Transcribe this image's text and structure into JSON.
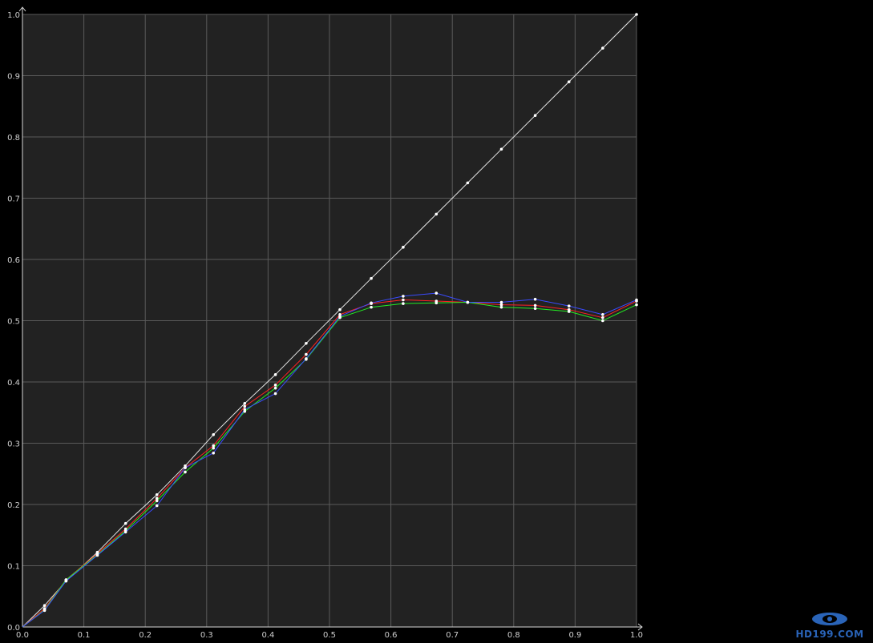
{
  "chart_data": {
    "type": "line",
    "title": "",
    "xlabel": "",
    "ylabel": "",
    "xlim": [
      0,
      1
    ],
    "ylim": [
      0,
      1
    ],
    "grid": true,
    "x_ticks": [
      "0.0",
      "0.1",
      "0.2",
      "0.3",
      "0.4",
      "0.5",
      "0.6",
      "0.7",
      "0.8",
      "0.9",
      "1.0"
    ],
    "y_ticks": [
      "0.0",
      "0.1",
      "0.2",
      "0.3",
      "0.4",
      "0.5",
      "0.6",
      "0.7",
      "0.8",
      "0.9",
      "1.0"
    ],
    "x": [
      0.0,
      0.036,
      0.071,
      0.122,
      0.168,
      0.219,
      0.265,
      0.311,
      0.362,
      0.412,
      0.462,
      0.517,
      0.568,
      0.62,
      0.674,
      0.725,
      0.78,
      0.835,
      0.89,
      0.945,
      1.0
    ],
    "series": [
      {
        "color": "#e8e8e8",
        "values": [
          0.0,
          0.035,
          0.075,
          0.122,
          0.169,
          0.216,
          0.263,
          0.314,
          0.365,
          0.412,
          0.463,
          0.518,
          0.569,
          0.62,
          0.674,
          0.725,
          0.78,
          0.835,
          0.89,
          0.945,
          1.0
        ]
      },
      {
        "color": "#ff2222",
        "values": [
          0.0,
          0.03,
          0.077,
          0.12,
          0.16,
          0.21,
          0.26,
          0.296,
          0.36,
          0.395,
          0.445,
          0.51,
          0.528,
          0.534,
          0.532,
          0.53,
          0.526,
          0.525,
          0.518,
          0.505,
          0.532
        ]
      },
      {
        "color": "#22ee22",
        "values": [
          0.0,
          0.028,
          0.077,
          0.118,
          0.157,
          0.206,
          0.253,
          0.292,
          0.352,
          0.39,
          0.437,
          0.505,
          0.522,
          0.528,
          0.529,
          0.53,
          0.522,
          0.52,
          0.515,
          0.5,
          0.526
        ]
      },
      {
        "color": "#3a4bff",
        "values": [
          0.0,
          0.027,
          0.075,
          0.117,
          0.155,
          0.198,
          0.26,
          0.284,
          0.355,
          0.381,
          0.438,
          0.507,
          0.529,
          0.54,
          0.545,
          0.53,
          0.53,
          0.535,
          0.524,
          0.51,
          0.534
        ]
      }
    ]
  },
  "watermark": {
    "text": "HD199.COM",
    "color": "#2a64b8"
  },
  "colors": {
    "plot_background": "#222222",
    "page_background": "#000000",
    "grid": "#5a5a5a",
    "axis": "#d8d8d8"
  }
}
